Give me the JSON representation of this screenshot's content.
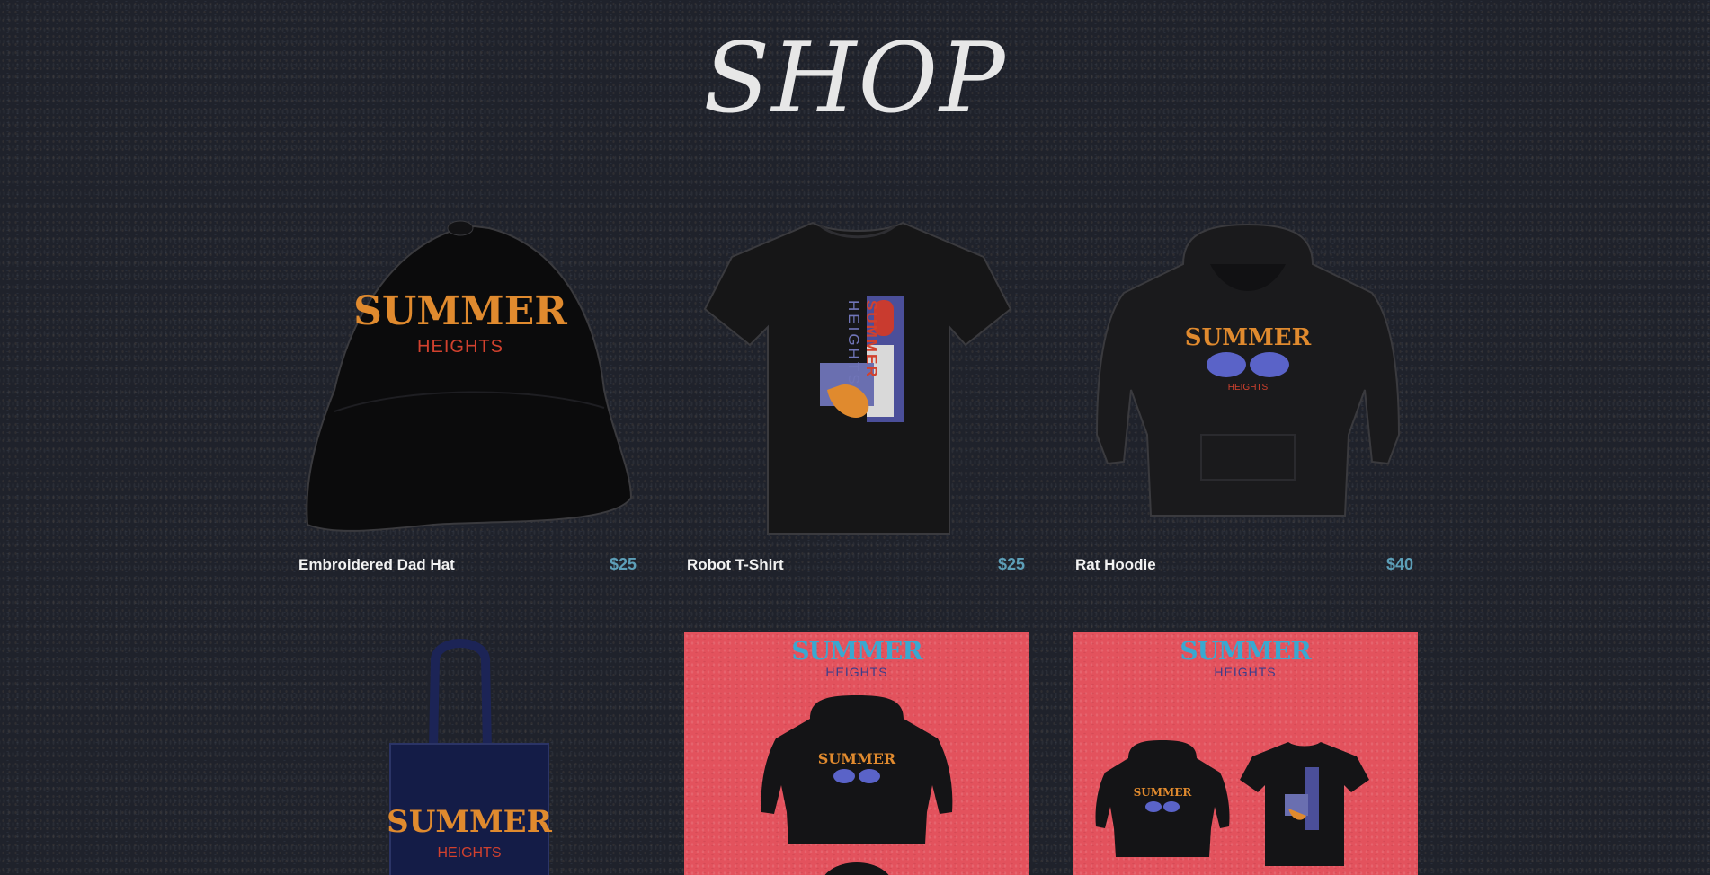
{
  "page": {
    "title": "SHOP"
  },
  "products": [
    {
      "name": "Embroidered Dad Hat",
      "price": "$25",
      "icon": "hat-image",
      "logo_top": "SUMMER",
      "logo_bottom": "HEIGHTS"
    },
    {
      "name": "Robot T-Shirt",
      "price": "$25",
      "icon": "tshirt-image",
      "logo_top": "SUMMER",
      "logo_bottom": "HEIGHTS"
    },
    {
      "name": "Rat Hoodie",
      "price": "$40",
      "icon": "hoodie-image",
      "logo_top": "SUMMER",
      "logo_bottom": "HEIGHTS"
    },
    {
      "icon": "tote-bag-image",
      "logo_top": "SUMMER",
      "logo_bottom": "HEIGHTS"
    },
    {
      "icon": "hoodie-bundle-image",
      "logo_top": "SUMMER",
      "logo_bottom": "HEIGHTS"
    },
    {
      "icon": "hoodie-tshirt-bundle-image",
      "logo_top": "SUMMER",
      "logo_bottom": "HEIGHTS"
    }
  ],
  "colors": {
    "background": "#1f222b",
    "price": "#5d9fb8",
    "promo_bg": "#e3525d",
    "logo_orange": "#e08a2e",
    "logo_red": "#d2412e",
    "logo_blue": "#3aa8d0"
  }
}
